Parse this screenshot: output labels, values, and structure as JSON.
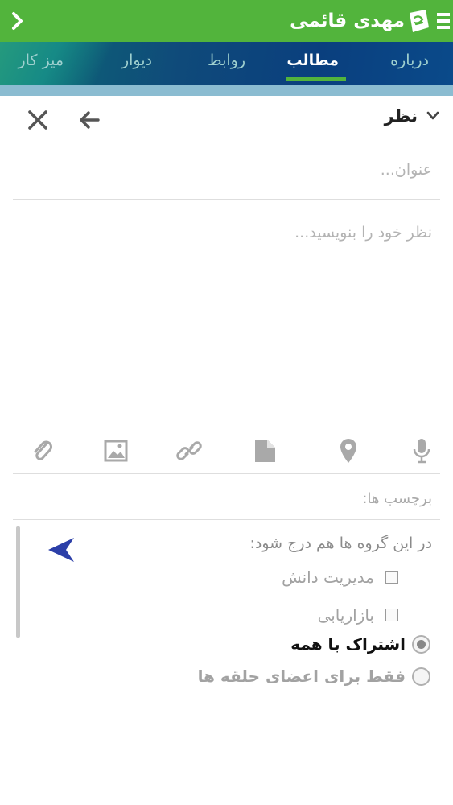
{
  "header": {
    "user_name": "مهدی قائمی",
    "back_icon": "chevron-right-icon",
    "menu_icon": "hamburger-menu-icon",
    "logo_icon": "app-logo-icon"
  },
  "tabs": [
    {
      "label": "درباره"
    },
    {
      "label": "مطالب"
    },
    {
      "label": "روابط"
    },
    {
      "label": "دیوار"
    },
    {
      "label": "میز کار"
    }
  ],
  "active_tab": "مطالب",
  "composer": {
    "type_label": "نظر",
    "title_placeholder": "عنوان...",
    "body_placeholder": "نظر خود را بنویسید...",
    "tags_placeholder": "برچسب ها:",
    "toolbar_icons": [
      "attachment-icon",
      "image-icon",
      "link-icon",
      "document-icon",
      "location-icon",
      "microphone-icon"
    ]
  },
  "groups": {
    "heading": "در این گروه ها هم درج شود:",
    "items": [
      {
        "label": "مدیریت دانش",
        "checked": false
      },
      {
        "label": "بازاریابی",
        "checked": false
      }
    ]
  },
  "share": {
    "options": [
      {
        "label": "اشتراک با همه",
        "selected": true
      },
      {
        "label": "فقط برای اعضای حلقه ها",
        "selected": false
      }
    ]
  },
  "colors": {
    "header_green": "#52b43c",
    "tab_bar": "#0a3f7e",
    "send_arrow": "#2c3fa8"
  }
}
